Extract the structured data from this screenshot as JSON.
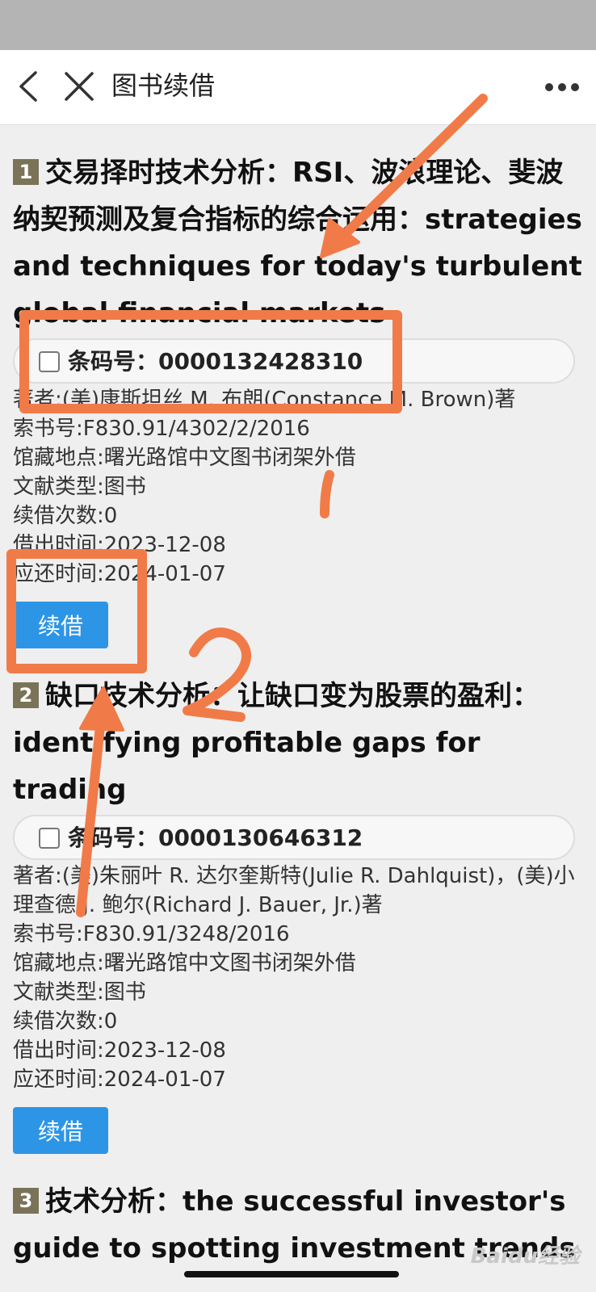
{
  "nav": {
    "title": "图书续借"
  },
  "books": [
    {
      "num": "1",
      "title": "交易择时技术分析：RSI、波浪理论、斐波纳契预测及复合指标的综合运用：strategies and techniques for today's turbulent global financial markets",
      "barcode_label": "条码号：",
      "barcode_value": "0000132428310",
      "author": "著者:(美)康斯坦丝 M. 布朗(Constance M. Brown)著",
      "call_number": "索书号:F830.91/4302/2/2016",
      "location": "馆藏地点:曙光路馆中文图书闭架外借",
      "doc_type": "文献类型:图书",
      "renew_count": "续借次数:0",
      "loan_date": "借出时间:2023-12-08",
      "due_date": "应还时间:2024-01-07",
      "renew_label": "续借"
    },
    {
      "num": "2",
      "title": "缺口技术分析：让缺口变为股票的盈利：identifying profitable gaps for trading",
      "barcode_label": "条码号：",
      "barcode_value": "0000130646312",
      "author": "著者:(美)朱丽叶 R. 达尔奎斯特(Julie R. Dahlquist)，(美)小理查德 J. 鲍尔(Richard J. Bauer, Jr.)著",
      "call_number": "索书号:F830.91/3248/2016",
      "location": "馆藏地点:曙光路馆中文图书闭架外借",
      "doc_type": "文献类型:图书",
      "renew_count": "续借次数:0",
      "loan_date": "借出时间:2023-12-08",
      "due_date": "应还时间:2024-01-07",
      "renew_label": "续借"
    },
    {
      "num": "3",
      "title": "技术分析：the successful investor's guide to spotting investment trends and turning points"
    }
  ],
  "annotations": {
    "mark_1": "1",
    "mark_2": "2",
    "color": "#f07b48"
  },
  "watermark": "Baidu经验"
}
